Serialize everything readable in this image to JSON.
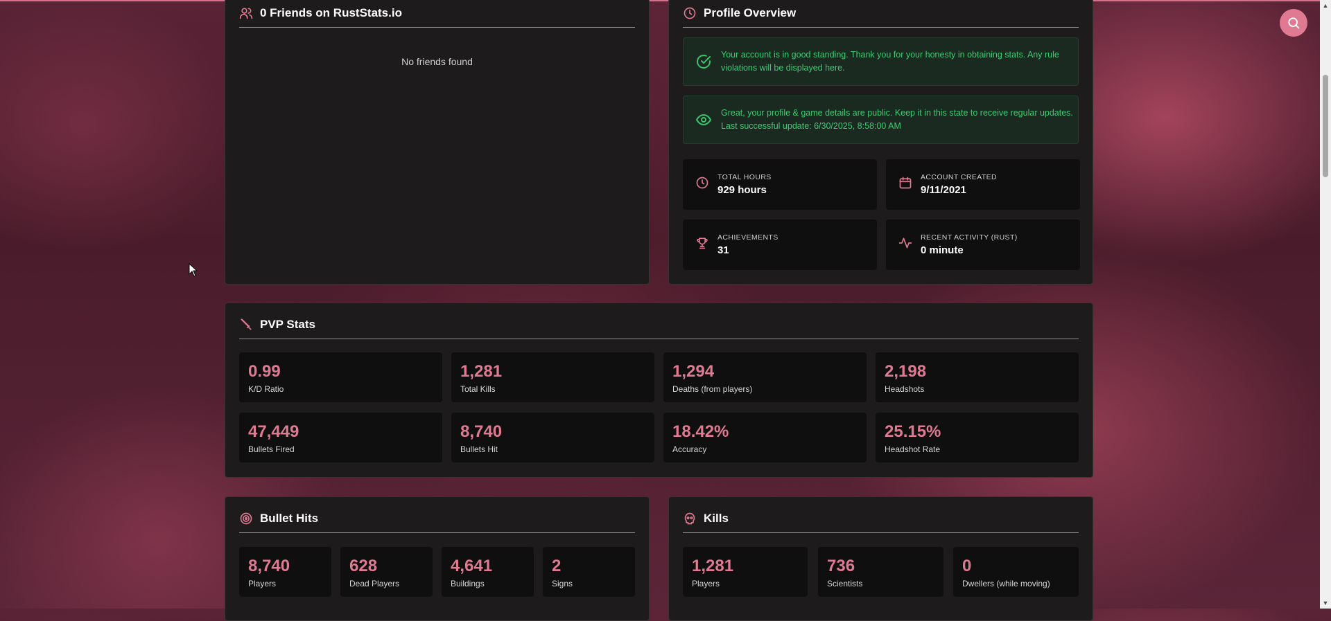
{
  "friends": {
    "title": "0 Friends on RustStats.io",
    "empty": "No friends found"
  },
  "profile": {
    "title": "Profile Overview",
    "notices": [
      {
        "icon": "check-circle-icon",
        "line1": "Your account is in good standing. Thank you for your honesty in obtaining stats. Any rule",
        "line2": "violations will be displayed here."
      },
      {
        "icon": "eye-icon",
        "line1": "Great, your profile & game details are public. Keep it in this state to receive regular updates.",
        "line2": "Last successful update: 6/30/2025, 8:58:00 AM"
      }
    ],
    "stats": [
      {
        "icon": "clock-icon",
        "label": "TOTAL HOURS",
        "value": "929 hours"
      },
      {
        "icon": "calendar-icon",
        "label": "ACCOUNT CREATED",
        "value": "9/11/2021"
      },
      {
        "icon": "trophy-icon",
        "label": "ACHIEVEMENTS",
        "value": "31"
      },
      {
        "icon": "activity-icon",
        "label": "RECENT ACTIVITY (RUST)",
        "value": "0 minute"
      }
    ]
  },
  "pvp": {
    "title": "PVP Stats",
    "items": [
      {
        "value": "0.99",
        "label": "K/D Ratio"
      },
      {
        "value": "1,281",
        "label": "Total Kills"
      },
      {
        "value": "1,294",
        "label": "Deaths (from players)"
      },
      {
        "value": "2,198",
        "label": "Headshots"
      },
      {
        "value": "47,449",
        "label": "Bullets Fired"
      },
      {
        "value": "8,740",
        "label": "Bullets Hit"
      },
      {
        "value": "18.42%",
        "label": "Accuracy"
      },
      {
        "value": "25.15%",
        "label": "Headshot Rate"
      }
    ]
  },
  "bullet_hits": {
    "title": "Bullet Hits",
    "items": [
      {
        "value": "8,740",
        "label": "Players"
      },
      {
        "value": "628",
        "label": "Dead Players"
      },
      {
        "value": "4,641",
        "label": "Buildings"
      },
      {
        "value": "2",
        "label": "Signs"
      }
    ]
  },
  "kills": {
    "title": "Kills",
    "items": [
      {
        "value": "1,281",
        "label": "Players"
      },
      {
        "value": "736",
        "label": "Scientists"
      },
      {
        "value": "0",
        "label": "Dwellers (while moving)"
      }
    ]
  },
  "colors": {
    "accent": "#e07a93",
    "success": "#3ccb72",
    "panel": "#1d1b1c",
    "card": "#0f0f10"
  }
}
